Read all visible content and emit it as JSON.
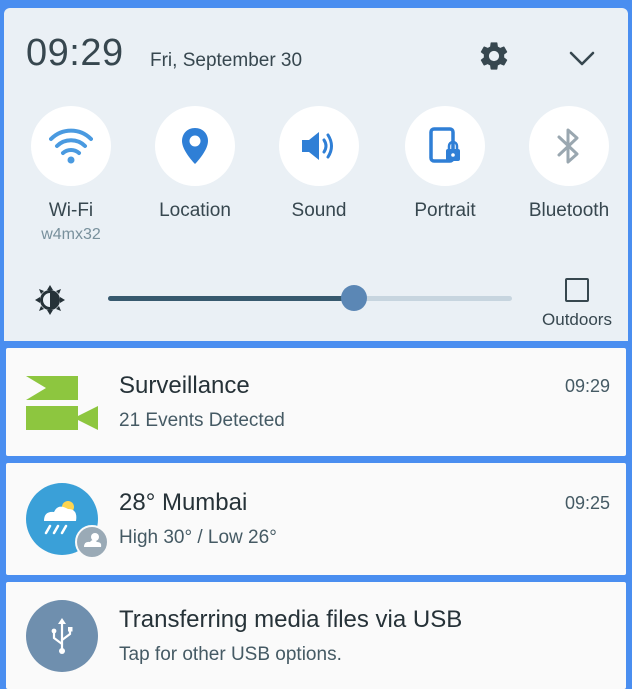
{
  "status": {
    "time": "09:29",
    "date": "Fri, September 30"
  },
  "quick_tiles": [
    {
      "label": "Wi-Fi",
      "sub": "w4mx32",
      "icon": "wifi-icon",
      "color": "#4a9ae0"
    },
    {
      "label": "Location",
      "icon": "location-pin-icon",
      "color": "#2f7fd6"
    },
    {
      "label": "Sound",
      "icon": "speaker-icon",
      "color": "#2f7fd6"
    },
    {
      "label": "Portrait",
      "icon": "portrait-lock-icon",
      "color": "#2f7fd6"
    },
    {
      "label": "Bluetooth",
      "icon": "bluetooth-icon",
      "color": "#9aa7b0"
    }
  ],
  "brightness": {
    "level": 0.61,
    "outdoors_label": "Outdoors"
  },
  "notifications": [
    {
      "title": "Surveillance",
      "text": "21 Events Detected",
      "time": "09:29",
      "icon": "surveillance-camera-icon"
    },
    {
      "title": "28° Mumbai",
      "text": "High 30° / Low 26°",
      "time": "09:25",
      "icon": "weather-icon"
    },
    {
      "title": "Transferring media files via USB",
      "text": "Tap for other USB options.",
      "icon": "usb-icon"
    }
  ],
  "colors": {
    "accent": "#4a8ef0",
    "panel": "#eaf0f5",
    "surveillance_green": "#8dc63f",
    "weather_blue": "#3aa0d8",
    "usb_gray": "#6f8fae"
  }
}
